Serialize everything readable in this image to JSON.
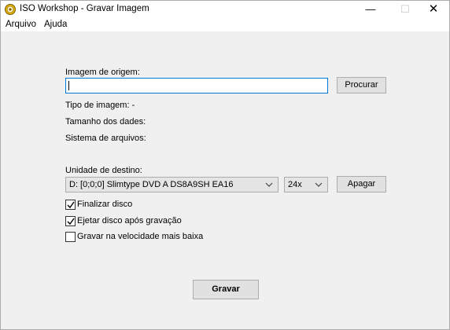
{
  "window": {
    "title": "ISO Workshop - Gravar Imagem"
  },
  "menu": {
    "items": [
      "Arquivo",
      "Ajuda"
    ]
  },
  "source": {
    "label": "Imagem de origem:",
    "value": "",
    "browse_label": "Procurar"
  },
  "info": {
    "image_type": "Tipo de imagem:  -",
    "data_size": "Tamanho dos dades:",
    "file_system": "Sistema de arquivos:"
  },
  "destination": {
    "label": "Unidade de destino:",
    "drive": "D:  [0;0;0] Slimtype DVD A  DS8A9SH EA16",
    "speed": "24x",
    "erase_label": "Apagar"
  },
  "options": [
    {
      "label": "Finalizar disco",
      "checked": true
    },
    {
      "label": "Ejetar disco após gravação",
      "checked": true
    },
    {
      "label": "Gravar na velocidade mais baixa",
      "checked": false
    }
  ],
  "actions": {
    "burn_label": "Gravar"
  },
  "colors": {
    "focus_border": "#0078d7",
    "titlebar": "#ffffff",
    "client": "#f0f0f0"
  }
}
